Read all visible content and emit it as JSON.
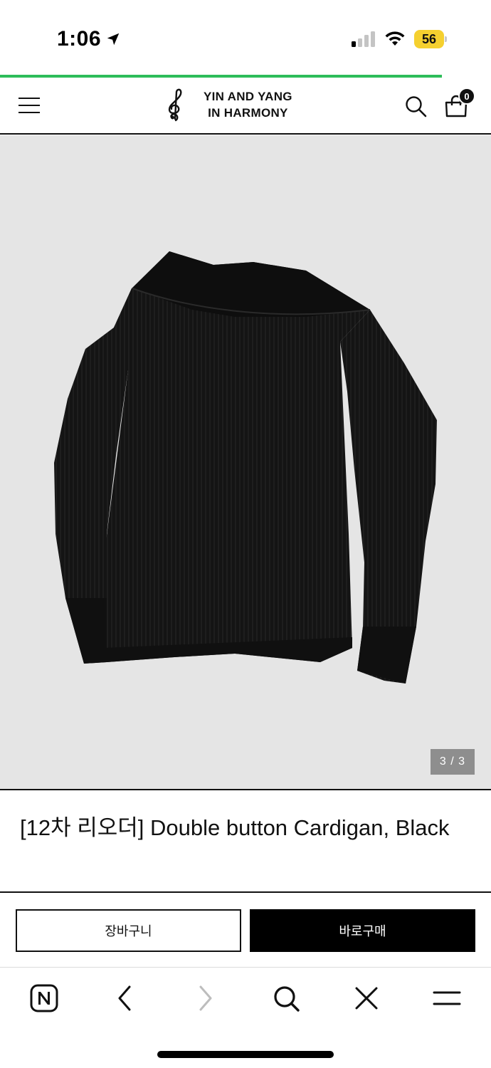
{
  "status_bar": {
    "time": "1:06",
    "battery_level": "56"
  },
  "page_load_progress": 0.9,
  "header": {
    "brand_line1": "YIN AND YANG",
    "brand_line2": "IN HARMONY",
    "cart_count": "0"
  },
  "product": {
    "slide_counter": "3 / 3",
    "title": "[12차 리오더] Double button Cardigan, Black"
  },
  "actions": {
    "cart_label": "장바구니",
    "buy_label": "바로구매"
  },
  "browser_toolbar": {
    "items": [
      "naver-home-icon",
      "back-icon",
      "forward-icon",
      "search-icon",
      "close-icon",
      "menu-icon"
    ]
  },
  "colors": {
    "progress": "#2ebd5a",
    "battery": "#f5d02f",
    "image_bg": "#e5e5e5",
    "buy_button": "#000000"
  }
}
